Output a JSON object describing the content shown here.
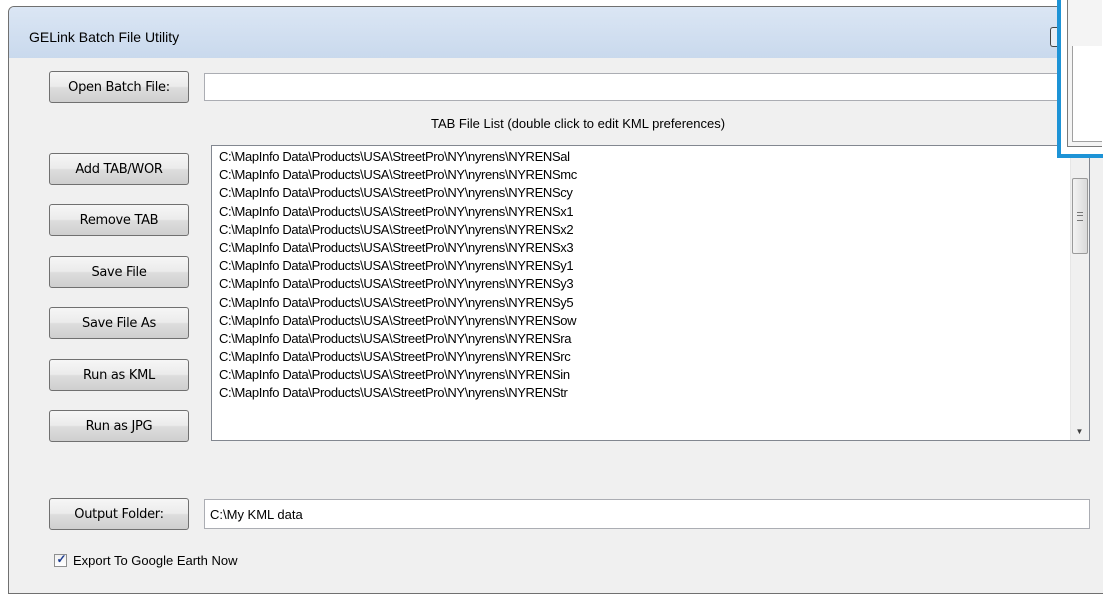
{
  "window": {
    "title": "GELink Batch File Utility"
  },
  "batch": {
    "open_button_label": "Open Batch File:",
    "file_value": ""
  },
  "tab_list": {
    "caption": "TAB File List (double click to edit KML preferences)",
    "items": [
      "C:\\MapInfo Data\\Products\\USA\\StreetPro\\NY\\nyrens\\NYRENSal",
      "C:\\MapInfo Data\\Products\\USA\\StreetPro\\NY\\nyrens\\NYRENSmc",
      "C:\\MapInfo Data\\Products\\USA\\StreetPro\\NY\\nyrens\\NYRENScy",
      "C:\\MapInfo Data\\Products\\USA\\StreetPro\\NY\\nyrens\\NYRENSx1",
      "C:\\MapInfo Data\\Products\\USA\\StreetPro\\NY\\nyrens\\NYRENSx2",
      "C:\\MapInfo Data\\Products\\USA\\StreetPro\\NY\\nyrens\\NYRENSx3",
      "C:\\MapInfo Data\\Products\\USA\\StreetPro\\NY\\nyrens\\NYRENSy1",
      "C:\\MapInfo Data\\Products\\USA\\StreetPro\\NY\\nyrens\\NYRENSy3",
      "C:\\MapInfo Data\\Products\\USA\\StreetPro\\NY\\nyrens\\NYRENSy5",
      "C:\\MapInfo Data\\Products\\USA\\StreetPro\\NY\\nyrens\\NYRENSow",
      "C:\\MapInfo Data\\Products\\USA\\StreetPro\\NY\\nyrens\\NYRENSra",
      "C:\\MapInfo Data\\Products\\USA\\StreetPro\\NY\\nyrens\\NYRENSrc",
      "C:\\MapInfo Data\\Products\\USA\\StreetPro\\NY\\nyrens\\NYRENSin",
      "C:\\MapInfo Data\\Products\\USA\\StreetPro\\NY\\nyrens\\NYRENStr"
    ]
  },
  "actions": {
    "add_tab_wor": "Add TAB/WOR",
    "remove_tab": "Remove TAB",
    "save_file": "Save File",
    "save_file_as": "Save File As",
    "run_as_kml": "Run as KML",
    "run_as_jpg": "Run as JPG"
  },
  "output": {
    "button_label": "Output Folder:",
    "folder_value": "C:\\My KML data"
  },
  "export": {
    "label": "Export To Google Earth Now",
    "checked": true
  },
  "icons": {
    "scroll_up": "chevron-up-icon",
    "scroll_down": "chevron-down-icon",
    "check": "checkmark-icon"
  }
}
